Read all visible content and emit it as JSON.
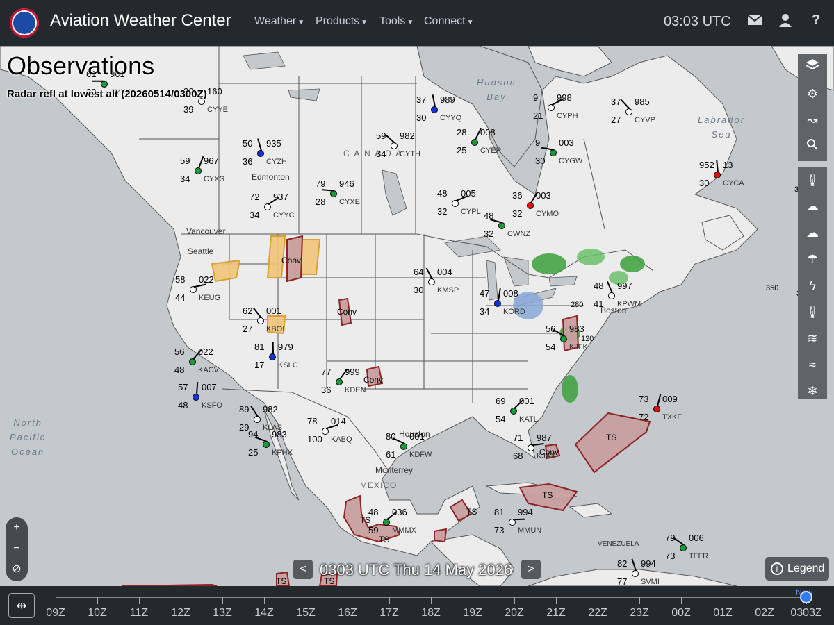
{
  "header": {
    "site_title": "Aviation Weather Center",
    "nav": [
      {
        "label": "Weather"
      },
      {
        "label": "Products"
      },
      {
        "label": "Tools"
      },
      {
        "label": "Connect"
      }
    ],
    "clock": "03:03 UTC",
    "icons": [
      "envelope-icon",
      "user-icon",
      "help-icon"
    ]
  },
  "page": {
    "title": "Observations",
    "layer_caption": "Radar refl at lowest alt (20260514/0300Z)"
  },
  "map": {
    "ocean_labels": [
      {
        "text": "North\nPacific\nOcean"
      },
      {
        "text": "Hudson\nBay"
      },
      {
        "text": "Labrador\nSea"
      }
    ],
    "places": [
      {
        "text": "Edmonton"
      },
      {
        "text": "C A N A D A"
      },
      {
        "text": "Vancouver"
      },
      {
        "text": "Seattle"
      },
      {
        "text": "Boston"
      },
      {
        "text": "Houston"
      },
      {
        "text": "Monterrey"
      },
      {
        "text": "MEXICO"
      },
      {
        "text": "VENEZUELA"
      }
    ],
    "stations": [
      {
        "id": "CYXX",
        "temp": "61",
        "dew": "30",
        "press": "961"
      },
      {
        "id": "CYYE",
        "temp": "30",
        "dew": "39",
        "press": "160"
      },
      {
        "id": "CYZH",
        "temp": "50",
        "dew": "36",
        "press": "935"
      },
      {
        "id": "CYXS",
        "temp": "59",
        "dew": "34",
        "press": "967"
      },
      {
        "id": "CYYC",
        "temp": "72",
        "dew": "34",
        "press": "937"
      },
      {
        "id": "CYXE",
        "temp": "79",
        "dew": "28",
        "press": "946"
      },
      {
        "id": "CYTH",
        "temp": "59",
        "dew": "34",
        "press": "982"
      },
      {
        "id": "CYYQ",
        "temp": "37",
        "dew": "30",
        "press": "989"
      },
      {
        "id": "CYER",
        "temp": "28",
        "dew": "25",
        "press": "008"
      },
      {
        "id": "CYPH",
        "temp": "9",
        "dew": "21",
        "press": "998"
      },
      {
        "id": "CYGW",
        "temp": "9",
        "dew": "30",
        "press": "003"
      },
      {
        "id": "CYVP",
        "temp": "37",
        "dew": "27",
        "press": "985"
      },
      {
        "id": "CYCA",
        "temp": "952",
        "dew": "30",
        "press": "13"
      },
      {
        "id": "CYMO",
        "temp": "36",
        "dew": "32",
        "press": "003"
      },
      {
        "id": "CYPL",
        "temp": "48",
        "dew": "32",
        "press": "005"
      },
      {
        "id": "CWNZ",
        "temp": "48",
        "dew": "32",
        "press": ""
      },
      {
        "id": "KBOI",
        "temp": "62",
        "dew": "27",
        "press": "001"
      },
      {
        "id": "KSLC",
        "temp": "81",
        "dew": "17",
        "press": "979"
      },
      {
        "id": "KDEN",
        "temp": "77",
        "dew": "36",
        "press": "999"
      },
      {
        "id": "KABQ",
        "temp": "78",
        "dew": "100",
        "press": "014"
      },
      {
        "id": "KPHX",
        "temp": "94",
        "dew": "25",
        "press": "983"
      },
      {
        "id": "KLAS",
        "temp": "89",
        "dew": "29",
        "press": "982"
      },
      {
        "id": "KSFO",
        "temp": "57",
        "dew": "48",
        "press": "007"
      },
      {
        "id": "KACV",
        "temp": "56",
        "dew": "48",
        "press": "022"
      },
      {
        "id": "KEUG",
        "temp": "58",
        "dew": "44",
        "press": "022"
      },
      {
        "id": "KDFW",
        "temp": "80",
        "dew": "61",
        "press": "001"
      },
      {
        "id": "KMSP",
        "temp": "64",
        "dew": "30",
        "press": "004"
      },
      {
        "id": "KORD",
        "temp": "47",
        "dew": "34",
        "press": "008"
      },
      {
        "id": "KATL",
        "temp": "69",
        "dew": "54",
        "press": "001"
      },
      {
        "id": "KJAX",
        "temp": "71",
        "dew": "68",
        "press": "987"
      },
      {
        "id": "KJFK",
        "temp": "56",
        "dew": "54",
        "press": "983"
      },
      {
        "id": "KPWM",
        "temp": "48",
        "dew": "41",
        "press": "997"
      },
      {
        "id": "TXKF",
        "temp": "73",
        "dew": "72",
        "press": "009"
      },
      {
        "id": "MMMX",
        "temp": "48",
        "dew": "59",
        "press": "036"
      },
      {
        "id": "MMUN",
        "temp": "81",
        "dew": "73",
        "press": "994"
      },
      {
        "id": "TFFR",
        "temp": "79",
        "dew": "73",
        "press": "006"
      },
      {
        "id": "SVMI",
        "temp": "82",
        "dew": "77",
        "press": "994"
      }
    ],
    "sigmet_labels": [
      "TS",
      "TS",
      "TS",
      "TS",
      "TS",
      "TS",
      "TS",
      "Conv",
      "Conv",
      "Conv",
      "Conv"
    ],
    "pirep_labels": [
      "350",
      "350",
      "340",
      "280",
      "120"
    ]
  },
  "right_tools": {
    "group1": [
      "layers-icon",
      "gear-icon",
      "route-icon",
      "search-icon"
    ],
    "group2": [
      "thermometer-wind-icon",
      "cloud-fog-icon",
      "cloud-icon",
      "umbrella-icon",
      "lightning-icon",
      "thermometer-icon",
      "wind-icon",
      "turbulence-icon",
      "icing-icon"
    ]
  },
  "zoom": {
    "in": "+",
    "out": "−",
    "reset": "⊘"
  },
  "time": {
    "label": "0303 UTC Thu 14 May 2026",
    "prev": "<",
    "next": ">"
  },
  "legend": {
    "label": "Legend"
  },
  "timeline": {
    "ticks": [
      "09Z",
      "10Z",
      "11Z",
      "12Z",
      "13Z",
      "14Z",
      "15Z",
      "16Z",
      "17Z",
      "18Z",
      "19Z",
      "20Z",
      "21Z",
      "22Z",
      "23Z",
      "00Z",
      "01Z",
      "02Z",
      "0303Z"
    ],
    "now_label": "Now"
  },
  "colors": {
    "header_bg": "#24292e",
    "land": "#ededed",
    "ocean": "#c4c9ce",
    "sigmet": "#8b1a1a",
    "radar_green": "#3ca03c",
    "station_green": "#1a9a3a",
    "station_blue": "#1434d8",
    "station_red": "#e01010",
    "pirep": "#ff8c00"
  }
}
